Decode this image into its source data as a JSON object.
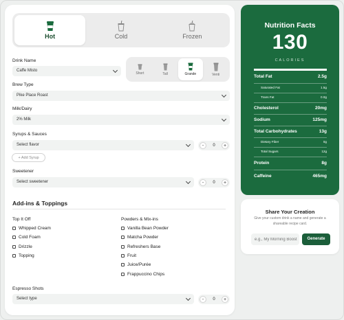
{
  "temperature_tabs": [
    {
      "label": "Hot",
      "active": true
    },
    {
      "label": "Cold",
      "active": false
    },
    {
      "label": "Frozen",
      "active": false
    }
  ],
  "drink_name": {
    "label": "Drink Name",
    "value": "Caffe Misto"
  },
  "sizes": [
    {
      "label": "Short",
      "active": false
    },
    {
      "label": "Tall",
      "active": false
    },
    {
      "label": "Grande",
      "active": true
    },
    {
      "label": "Venti",
      "active": false
    }
  ],
  "brew_type": {
    "label": "Brew Type",
    "value": "Pike Place Roast"
  },
  "milk": {
    "label": "Milk/Dairy",
    "value": "2% Milk"
  },
  "syrups": {
    "label": "Syrups & Sauces",
    "value": "Select flavor",
    "qty": "0",
    "add_label": "+ Add Syrup"
  },
  "sweetener": {
    "label": "Sweetener",
    "value": "Select sweetener",
    "qty": "0"
  },
  "addins": {
    "title": "Add-ins & Toppings",
    "top_it_off": {
      "title": "Top It Off",
      "items": [
        "Whipped Cream",
        "Cold Foam",
        "Drizzle",
        "Topping"
      ]
    },
    "powders": {
      "title": "Powders & Mix-ins",
      "items": [
        "Vanilla Bean Powder",
        "Matcha Powder",
        "Refreshers Base",
        "Fruit",
        "Juice/Purée",
        "Frappuccino Chips"
      ]
    }
  },
  "espresso": {
    "label": "Espresso Shots",
    "value": "Select type",
    "qty": "0"
  },
  "nutrition": {
    "title": "Nutrition Facts",
    "calories": "130",
    "calories_label": "CALORIES",
    "rows": [
      {
        "label": "Total Fat",
        "value": "2.5g",
        "major": true
      },
      {
        "label": "Saturated Fat",
        "value": "1.5g",
        "major": false
      },
      {
        "label": "Trans Fat",
        "value": "0.0g",
        "major": false
      },
      {
        "label": "Cholesterol",
        "value": "20mg",
        "major": true
      },
      {
        "label": "Sodium",
        "value": "125mg",
        "major": true
      },
      {
        "label": "Total Carbohydrates",
        "value": "13g",
        "major": true
      },
      {
        "label": "Dietary Fiber",
        "value": "0g",
        "major": false
      },
      {
        "label": "Total Sugars",
        "value": "12g",
        "major": false
      },
      {
        "label": "Protein",
        "value": "8g",
        "major": true
      },
      {
        "label": "Caffeine",
        "value": "465mg",
        "major": true
      }
    ]
  },
  "share": {
    "title": "Share Your Creation",
    "description": "Give your custom drink a name and generate a shareable recipe card.",
    "placeholder": "e.g., My Morning Boost",
    "button": "Generate"
  },
  "colors": {
    "brand_green": "#1b6b3e",
    "dark_green": "#1b5e3a"
  }
}
